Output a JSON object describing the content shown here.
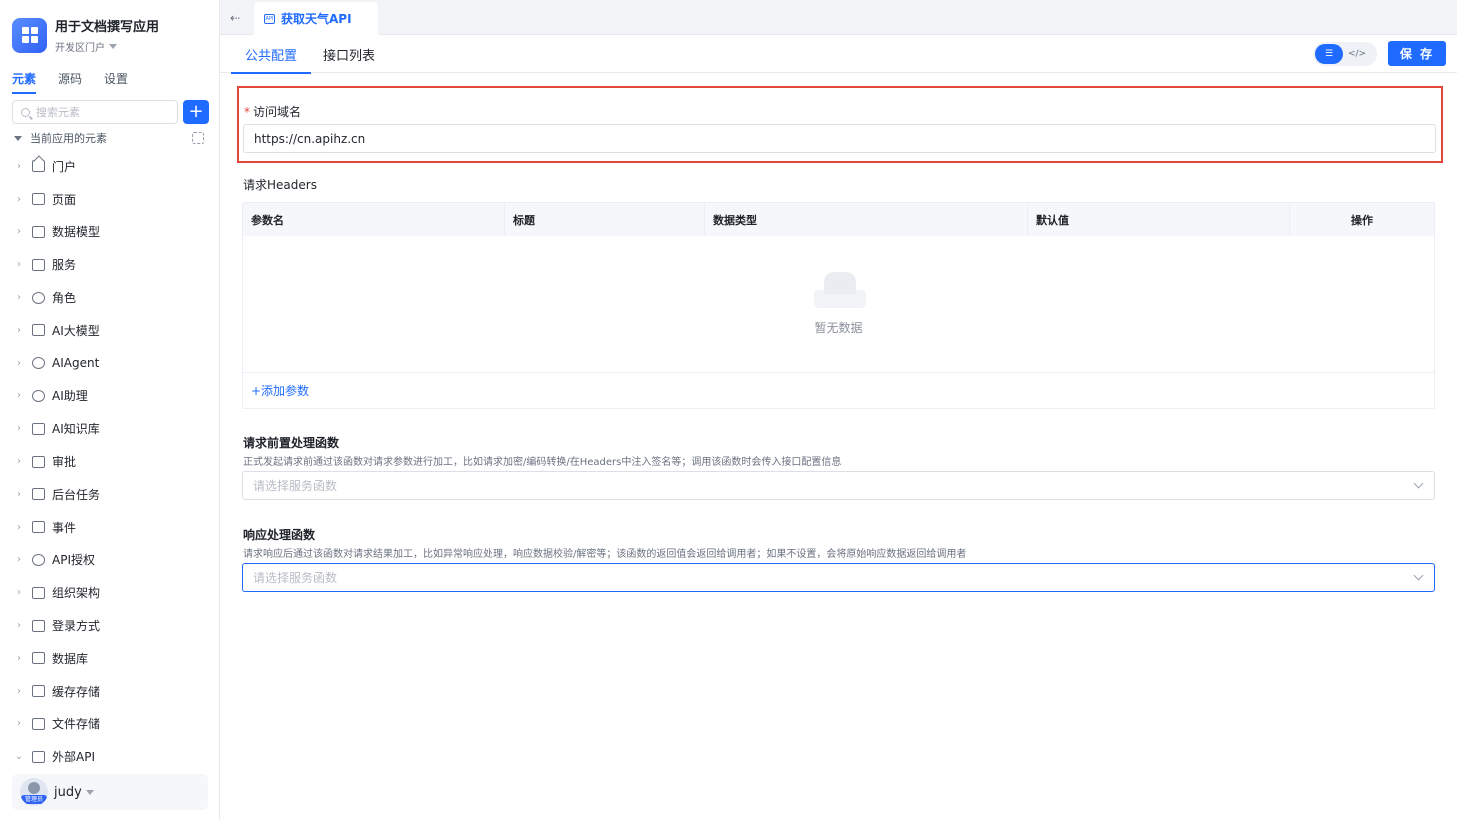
{
  "app": {
    "title": "用于文档撰写应用",
    "env": "开发区门户"
  },
  "side_tabs": [
    "元素",
    "源码",
    "设置"
  ],
  "search": {
    "placeholder": "搜索元素"
  },
  "tree_root": "当前应用的元素",
  "nav_items": [
    {
      "label": "门户",
      "icon": "home-icon"
    },
    {
      "label": "页面",
      "icon": "page-icon"
    },
    {
      "label": "数据模型",
      "icon": "table-icon"
    },
    {
      "label": "服务",
      "icon": "service-icon"
    },
    {
      "label": "角色",
      "icon": "role-icon"
    },
    {
      "label": "AI大模型",
      "icon": "cube-icon"
    },
    {
      "label": "AIAgent",
      "icon": "robot-icon"
    },
    {
      "label": "AI助理",
      "icon": "ai-assistant-icon"
    },
    {
      "label": "AI知识库",
      "icon": "book-icon"
    },
    {
      "label": "审批",
      "icon": "stamp-icon"
    },
    {
      "label": "后台任务",
      "icon": "task-icon"
    },
    {
      "label": "事件",
      "icon": "event-icon"
    },
    {
      "label": "API授权",
      "icon": "key-icon"
    },
    {
      "label": "组织架构",
      "icon": "org-icon"
    },
    {
      "label": "登录方式",
      "icon": "login-icon"
    },
    {
      "label": "数据库",
      "icon": "database-icon"
    },
    {
      "label": "缓存存储",
      "icon": "cache-icon"
    },
    {
      "label": "文件存储",
      "icon": "file-icon"
    },
    {
      "label": "外部API",
      "icon": "api-icon"
    }
  ],
  "user": {
    "name": "judy",
    "badge": "管理员"
  },
  "file_tab": {
    "label": "获取天气API",
    "icon_text": "API"
  },
  "sub_tabs": [
    "公共配置",
    "接口列表"
  ],
  "save_label": "保 存",
  "domain": {
    "label": "访问域名",
    "required": "*",
    "value": "https://cn.apihz.cn"
  },
  "headers": {
    "title": "请求Headers",
    "columns": [
      "参数名",
      "标题",
      "数据类型",
      "默认值",
      "操作"
    ],
    "empty_text": "暂无数据",
    "add_label": "+添加参数"
  },
  "pre_func": {
    "title": "请求前置处理函数",
    "desc": "正式发起请求前通过该函数对请求参数进行加工，比如请求加密/编码转换/在Headers中注入签名等；调用该函数时会传入接口配置信息",
    "placeholder": "请选择服务函数"
  },
  "resp_func": {
    "title": "响应处理函数",
    "desc": "请求响应后通过该函数对请求结果加工，比如异常响应处理，响应数据校验/解密等；该函数的返回值会返回给调用者；如果不设置，会将原始响应数据返回给调用者",
    "placeholder": "请选择服务函数"
  },
  "colors": {
    "accent": "#1f6bff",
    "highlight_border": "#e5473d"
  }
}
